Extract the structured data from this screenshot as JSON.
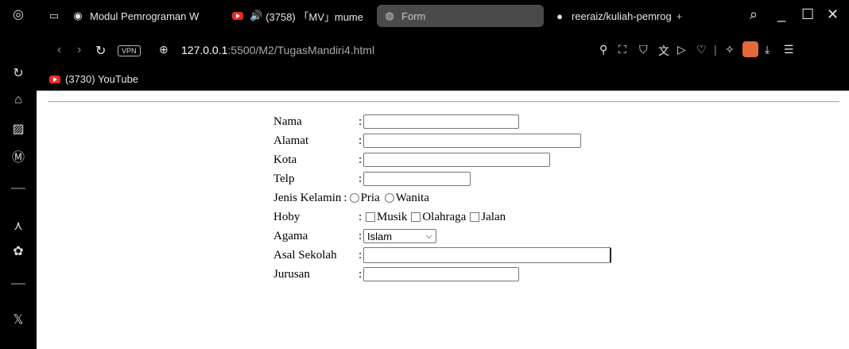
{
  "tabs": [
    {
      "label": "Modul Pemrograman W",
      "icon": "circle-logo-icon"
    },
    {
      "label": "(3758) 「MV」mume",
      "icon": "youtube-icon"
    },
    {
      "label": "Form",
      "icon": "globe-icon"
    },
    {
      "label": "reeraiz/kuliah-pemrog",
      "icon": "github-icon"
    }
  ],
  "address": {
    "vpn_label": "VPN",
    "url_host": "127.0.0.1",
    "url_path": ":5500/M2/TugasMandiri4.html"
  },
  "bookmarks": [
    {
      "label": "(3730) YouTube",
      "icon": "youtube-icon"
    }
  ],
  "form": {
    "nama_label": "Nama",
    "alamat_label": "Alamat",
    "kota_label": "Kota",
    "telp_label": "Telp",
    "jenis_kelamin_label": "Jenis Kelamin",
    "gender_options": [
      "Pria",
      "Wanita"
    ],
    "hoby_label": "Hoby",
    "hoby_options": [
      "Musik",
      "Olahraga",
      "Jalan"
    ],
    "agama_label": "Agama",
    "agama_selected": "Islam",
    "asal_sekolah_label": "Asal Sekolah",
    "jurusan_label": "Jurusan",
    "colon": ":"
  }
}
